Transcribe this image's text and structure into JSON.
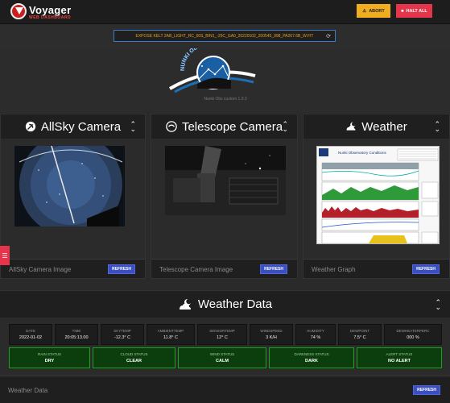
{
  "header": {
    "brand": "Voyager",
    "brand_sub": "WEB DASHBOARD",
    "abort_label": "ABORT",
    "halt_label": "HALT ALL"
  },
  "status": {
    "text": "EXPOSE KELT 2AB_LIGHT_RC_60S_BIN1_-25C_GA0_20220102_200545_998_PA267.6B_W.FIT"
  },
  "banner": {
    "logo_text": "NUNKI OBSERVATORY",
    "version": "Nunki Obs custom 1.0.3"
  },
  "cards": [
    {
      "title": "AllSky Camera",
      "footer": "AllSky Camera Image",
      "refresh": "REFRESH",
      "icon": "satellite-dish-icon"
    },
    {
      "title": "Telescope Camera",
      "footer": "Telescope Camera Image",
      "refresh": "REFRESH",
      "icon": "camera-lens-icon"
    },
    {
      "title": "Weather",
      "footer": "Weather Graph",
      "refresh": "REFRESH",
      "icon": "cloud-moon-icon"
    }
  ],
  "weather_graph": {
    "title": "Nunki Observatory Conditions"
  },
  "weather_data": {
    "title": "Weather Data",
    "footer": "Weather Data",
    "refresh": "REFRESH",
    "metrics": [
      {
        "label": "DATE",
        "value": "2022-01-02"
      },
      {
        "label": "TIME",
        "value": "20:05:13.00"
      },
      {
        "label": "SKYTEMP",
        "value": "-12.3° C"
      },
      {
        "label": "AMBIENTTEMP",
        "value": "11.8° C"
      },
      {
        "label": "SENSORTEMP",
        "value": "12° C"
      },
      {
        "label": "WINDSPEED",
        "value": "3 K/H"
      },
      {
        "label": "HUMIDITY",
        "value": "74 %"
      },
      {
        "label": "DEWPOINT",
        "value": "7.5° C"
      },
      {
        "label": "DEWHEATERPERC",
        "value": "000 %"
      }
    ],
    "statuses": [
      {
        "label": "RAIN STATUS",
        "value": "DRY"
      },
      {
        "label": "CLOUD STATUS",
        "value": "CLEAR"
      },
      {
        "label": "WIND STATUS",
        "value": "CALM"
      },
      {
        "label": "DARKNESS STATUS",
        "value": "DARK"
      },
      {
        "label": "ALERT STATUS",
        "value": "NO ALERT"
      }
    ]
  },
  "colors": {
    "abort": "#f0ad1f",
    "halt": "#e5354b",
    "refresh": "#3a4fc2",
    "status_ok": "#1aa21a"
  }
}
